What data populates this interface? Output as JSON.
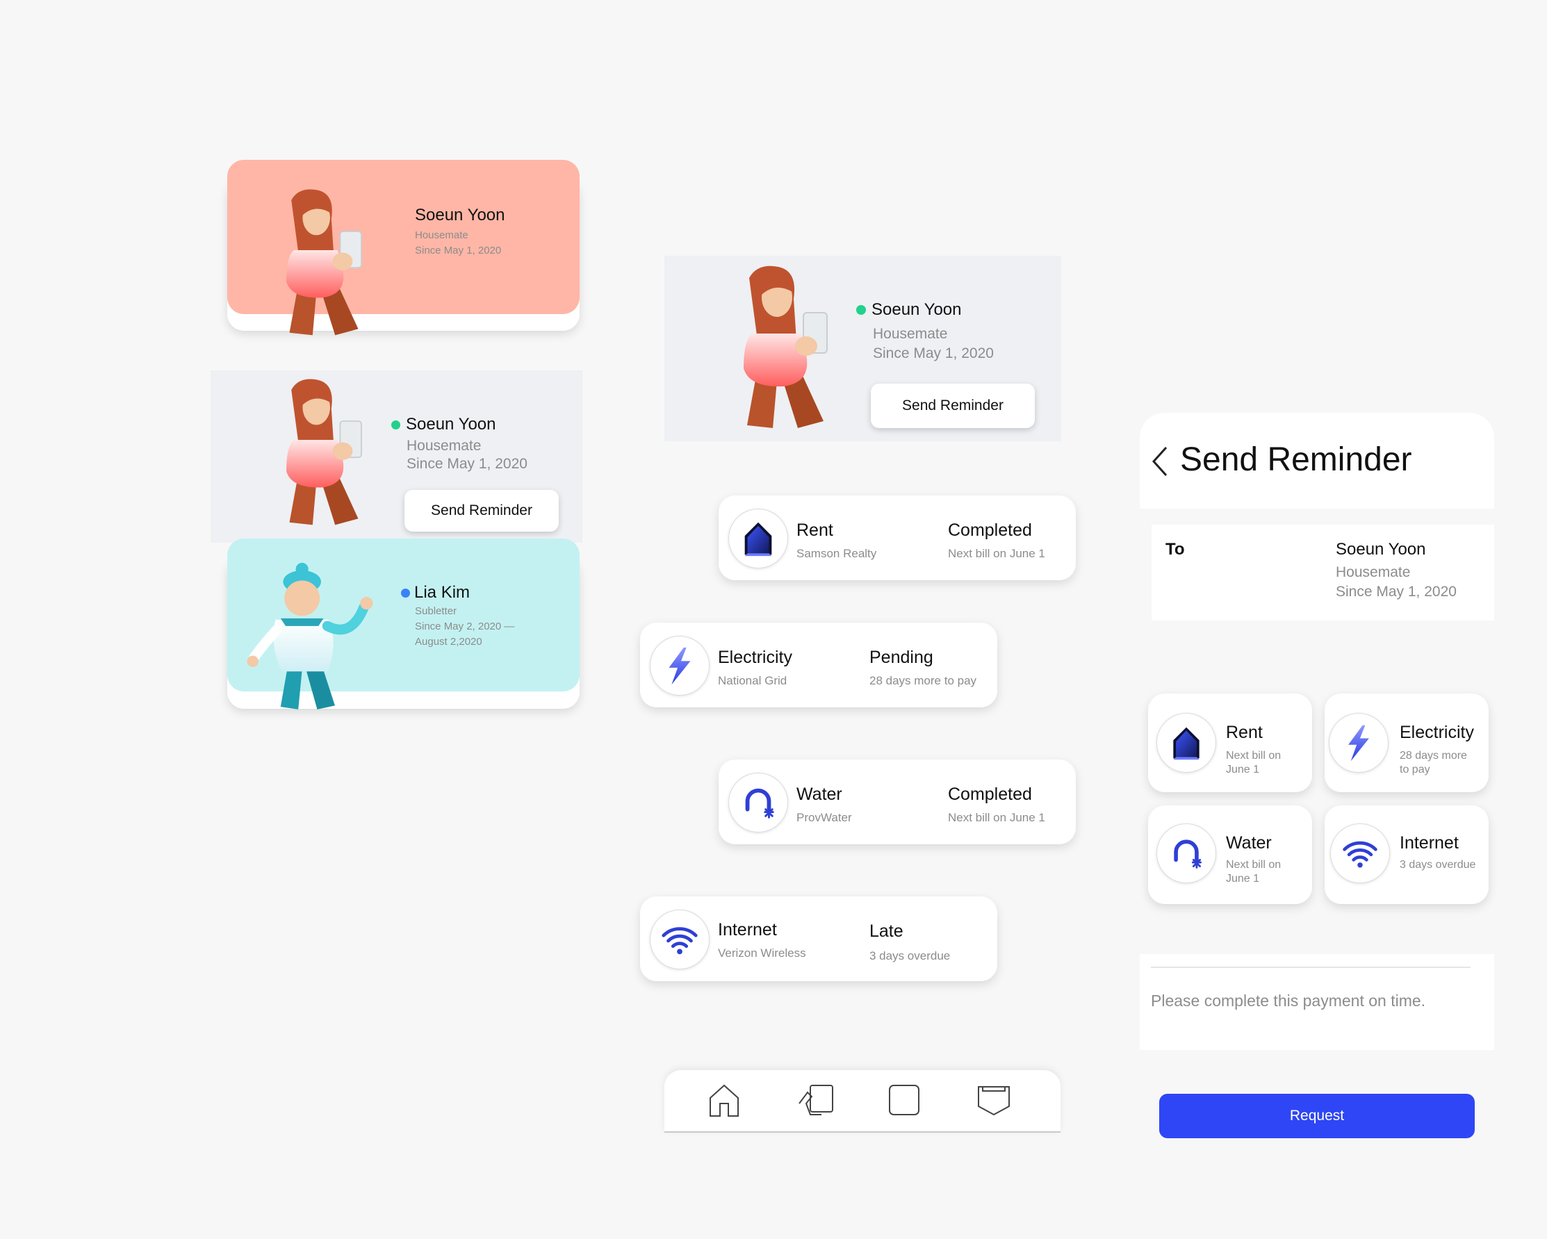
{
  "colors": {
    "background": "#f7f7f7",
    "salmon_card": "#ffb6a6",
    "mint_card": "#c3f1f1",
    "gray_panel": "#eef0f4",
    "online_dot": "#22d18b",
    "blue_dot": "#3b82f6",
    "accent_blue": "#2e46f5",
    "icon_blue": "#2f3fd6"
  },
  "profile_card_1": {
    "name": "Soeun Yoon",
    "role": "Housemate",
    "since": "Since May 1, 2020"
  },
  "profile_card_2": {
    "name": "Soeun Yoon",
    "role": "Housemate",
    "since": "Since May 1, 2020",
    "button": "Send Reminder"
  },
  "profile_card_3": {
    "name": "Lia Kim",
    "role": "Subletter",
    "since_line1": "Since May 2, 2020 —",
    "since_line2": "August 2,2020"
  },
  "profile_card_large": {
    "name": "Soeun Yoon",
    "role": "Housemate",
    "since": "Since May 1, 2020",
    "button": "Send Reminder"
  },
  "bills": [
    {
      "title": "Rent",
      "provider": "Samson Realty",
      "status": "Completed",
      "note": "Next bill on June 1",
      "icon": "house-icon"
    },
    {
      "title": "Electricity",
      "provider": "National Grid",
      "status": "Pending",
      "note": "28 days more to pay",
      "icon": "lightning-icon"
    },
    {
      "title": "Water",
      "provider": "ProvWater",
      "status": "Completed",
      "note": "Next bill on June 1",
      "icon": "faucet-icon"
    },
    {
      "title": "Internet",
      "provider": "Verizon Wireless",
      "status": "Late",
      "note": "3 days overdue",
      "icon": "wifi-icon"
    }
  ],
  "bottom_nav": [
    "home-icon",
    "hand-card-icon",
    "square-icon",
    "pocket-icon"
  ],
  "reminder": {
    "back_icon": "chevron-left-icon",
    "title": "Send Reminder",
    "to_label": "To",
    "recipient_name": "Soeun Yoon",
    "recipient_role": "Housemate",
    "recipient_since": "Since May 1, 2020",
    "tiles": [
      {
        "title": "Rent",
        "sub1": "Next bill on",
        "sub2": "June 1",
        "icon": "house-icon"
      },
      {
        "title": "Electricity",
        "sub1": "28 days more",
        "sub2": "to pay",
        "icon": "lightning-icon"
      },
      {
        "title": "Water",
        "sub1": "Next bill on",
        "sub2": "June 1",
        "icon": "faucet-icon"
      },
      {
        "title": "Internet",
        "sub1": "3 days overdue",
        "sub2": "",
        "icon": "wifi-icon"
      }
    ],
    "message": "Please complete this payment on time.",
    "request_button": "Request"
  }
}
